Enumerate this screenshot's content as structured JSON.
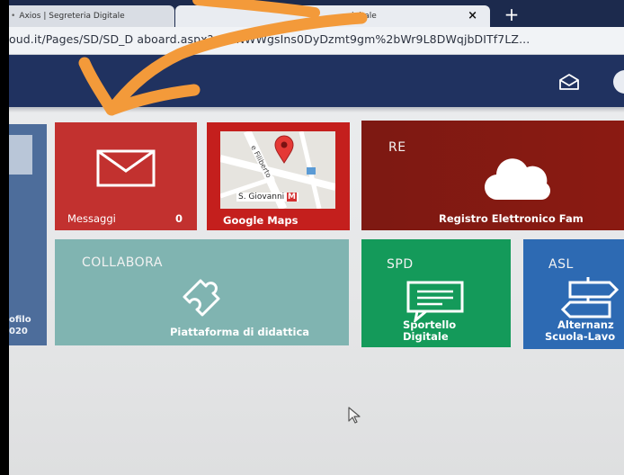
{
  "browser": {
    "tabs": [
      {
        "title": "Axios | Segreteria Digitale"
      },
      {
        "title": "igitale",
        "close": "×"
      }
    ],
    "new_tab": "+",
    "url": "oud.it/Pages/SD/SD_D   aboard.aspx?s=uNWWgsIns0DyDzmt9gm%2bWr9L8DWqjbDITf7LZ..."
  },
  "tiles": {
    "profile": {
      "label_line1": "ofilo",
      "label_line2": "020"
    },
    "messaggi": {
      "label": "Messaggi",
      "count": "0",
      "icon": "envelope-icon"
    },
    "google_maps": {
      "label": "Google Maps",
      "map_street": "e Filiberto",
      "map_station": "S. Giovanni",
      "map_metro": "M"
    },
    "registro": {
      "code": "RE",
      "label": "Registro Elettronico Fam",
      "icon": "cloud-icon"
    },
    "collabora": {
      "code": "COLLABORA",
      "label": "Piattaforma di didattica",
      "icon": "puzzle-icon"
    },
    "sportello": {
      "code": "SPD",
      "label_line1": "Sportello",
      "label_line2": "Digitale",
      "icon": "chat-icon"
    },
    "asl": {
      "code": "ASL",
      "label_line1": "Alternanz",
      "label_line2": "Scuola-Lavo",
      "icon": "signpost-icon"
    }
  },
  "colors": {
    "header": "#203260",
    "messaggi": "#c2312f",
    "google_maps": "#c41f1d",
    "registro": "#8b1a12",
    "collabora": "#80b4b1",
    "sportello": "#149a5a",
    "asl": "#2d6ab3",
    "annotation_arrow": "#f39a3a"
  }
}
